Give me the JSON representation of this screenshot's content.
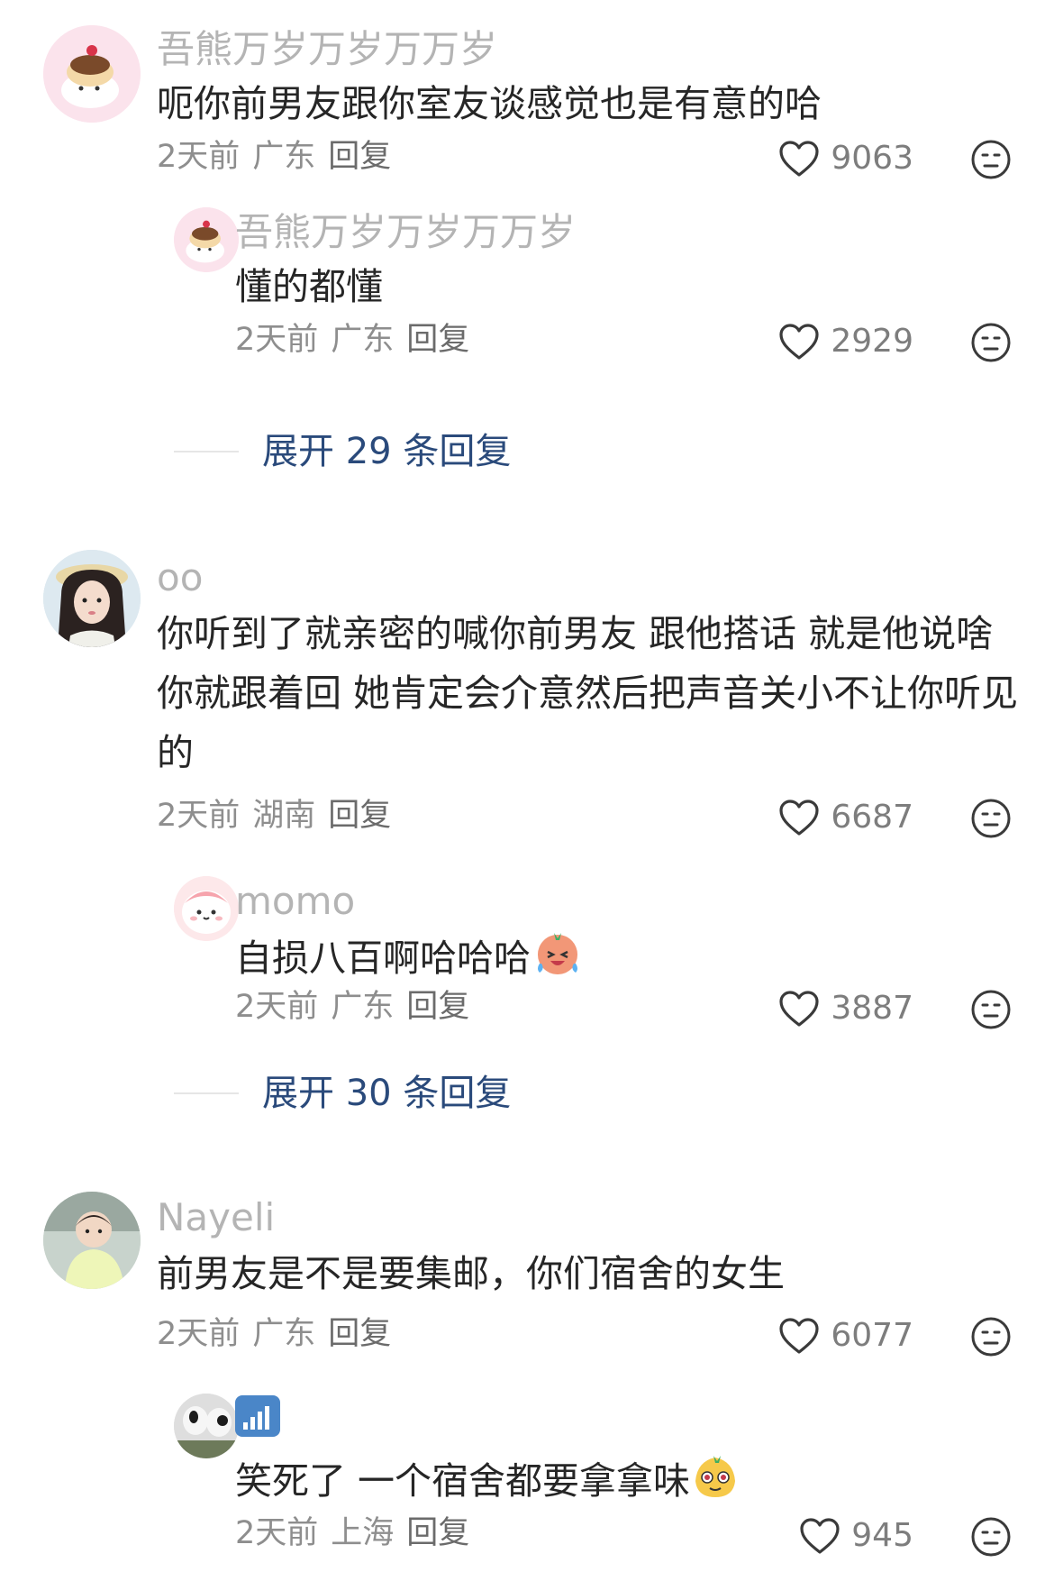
{
  "comments": [
    {
      "username": "吾熊万岁万岁万万岁",
      "text": "呃你前男友跟你室友谈感觉也是有意的哈",
      "time": "2天前",
      "location": "广东",
      "reply_label": "回复",
      "likes": "9063",
      "reply": {
        "username": "吾熊万岁万岁万万岁",
        "text": "懂的都懂",
        "time": "2天前",
        "location": "广东",
        "reply_label": "回复",
        "likes": "2929"
      },
      "expand_label": "展开 29 条回复"
    },
    {
      "username": "oo",
      "text": "你听到了就亲密的喊你前男友 跟他搭话 就是他说啥你就跟着回 她肯定会介意然后把声音关小不让你听见的",
      "time": "2天前",
      "location": "湖南",
      "reply_label": "回复",
      "likes": "6687",
      "reply": {
        "username": "momo",
        "text": "自损八百啊哈哈哈",
        "emoji": "laughing-crying-emoji",
        "time": "2天前",
        "location": "广东",
        "reply_label": "回复",
        "likes": "3887"
      },
      "expand_label": "展开 30 条回复"
    },
    {
      "username": "Nayeli",
      "text": "前男友是不是要集邮，你们宿舍的女生",
      "time": "2天前",
      "location": "广东",
      "reply_label": "回复",
      "likes": "6077",
      "reply": {
        "username_icon": "signal-bars-icon",
        "text": "笑死了 一个宿舍都要拿拿味",
        "emoji": "smug-face-emoji",
        "time": "2天前",
        "location": "上海",
        "reply_label": "回复",
        "likes": "945"
      }
    }
  ],
  "colors": {
    "link": "#2a4a7b",
    "username": "#b4b4b4",
    "text": "#262626",
    "meta": "#8e8e8e"
  }
}
